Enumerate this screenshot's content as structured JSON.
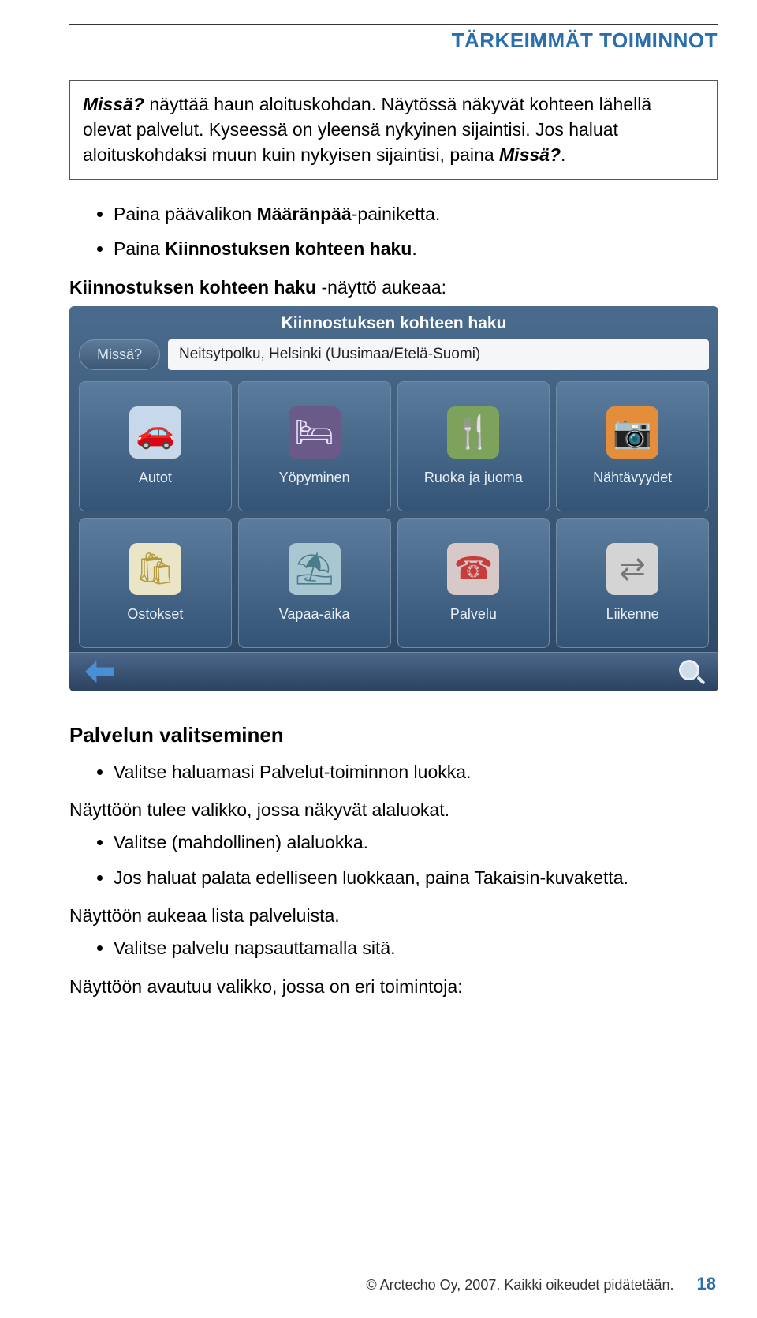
{
  "header": {
    "title": "TÄRKEIMMÄT TOIMINNOT"
  },
  "infobox": {
    "text_html": "<b><i>Missä?</i></b> näyttää haun aloituskohdan. Näytössä näkyvät kohteen lähellä olevat palvelut. Kyseessä on yleensä nykyinen sijaintisi. Jos haluat aloituskohdaksi muun kuin nykyisen sijaintisi, paina <b><i>Missä?</i></b>."
  },
  "bullets1": [
    "Paina päävalikon <b>Määränpää</b>-painiketta.",
    "Paina <b>Kiinnostuksen kohteen haku</b>."
  ],
  "line1": "<b>Kiinnostuksen kohteen haku</b> -näyttö aukeaa:",
  "gps": {
    "title": "Kiinnostuksen kohteen haku",
    "where": "Missä?",
    "location": "Neitsytpolku, Helsinki (Uusimaa/Etelä-Suomi)",
    "tiles_row1": [
      {
        "name": "autot",
        "label": "Autot",
        "glyph": "🚗",
        "cls": "ic-blue"
      },
      {
        "name": "yopyminen",
        "label": "Yöpyminen",
        "glyph": "🛏",
        "cls": "ic-purple"
      },
      {
        "name": "ruoka",
        "label": "Ruoka ja juoma",
        "glyph": "🍴",
        "cls": "ic-grn"
      },
      {
        "name": "nahtavyydet",
        "label": "Nähtävyydet",
        "glyph": "📷",
        "cls": "ic-org"
      }
    ],
    "tiles_row2": [
      {
        "name": "ostokset",
        "label": "Ostokset",
        "glyph": "🛍",
        "cls": "ic-yel"
      },
      {
        "name": "vapaa-aika",
        "label": "Vapaa-aika",
        "glyph": "⛱",
        "cls": "ic-cyan"
      },
      {
        "name": "palvelu",
        "label": "Palvelu",
        "glyph": "☎",
        "cls": "ic-red"
      },
      {
        "name": "liikenne",
        "label": "Liikenne",
        "glyph": "⇄",
        "cls": "ic-gray"
      }
    ]
  },
  "section2": {
    "heading": "Palvelun valitseminen",
    "b1": [
      "Valitse haluamasi Palvelut-toiminnon luokka."
    ],
    "line_a": "Näyttöön tulee valikko, jossa näkyvät alaluokat.",
    "b2": [
      "Valitse (mahdollinen) alaluokka.",
      "Jos haluat palata edelliseen luokkaan, paina Takaisin-kuvaketta."
    ],
    "line_b": "Näyttöön aukeaa lista palveluista.",
    "b3": [
      "Valitse palvelu napsauttamalla sitä."
    ],
    "line_c": "Näyttöön avautuu valikko, jossa on eri toimintoja:"
  },
  "footer": {
    "copyright": "© Arctecho Oy, 2007. Kaikki oikeudet pidätetään.",
    "page": "18"
  }
}
